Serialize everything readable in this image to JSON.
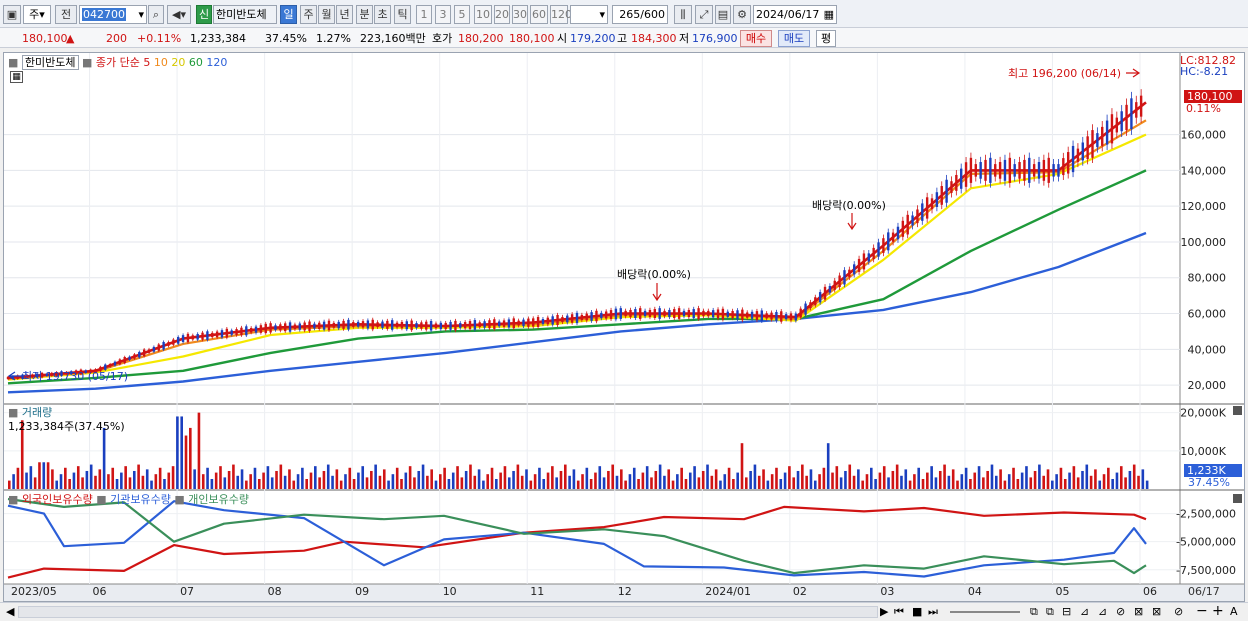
{
  "toolbar": {
    "period_type": "주",
    "prev_btn": "전",
    "stock_code": "042700",
    "credit_badge": "신",
    "stock_name": "한미반도체",
    "periods": [
      "일",
      "주",
      "월",
      "년",
      "분",
      "초",
      "틱"
    ],
    "active_period": "일",
    "tick_nums": [
      "1",
      "3",
      "5",
      "10",
      "20",
      "30",
      "60",
      "120"
    ],
    "count": "265",
    "count_max": "/600",
    "date": "2024/06/17"
  },
  "quote": {
    "price": "180,100",
    "change": "200",
    "change_pct": "+0.11%",
    "volume": "1,233,384",
    "turnover_rate": "37.45%",
    "ratio": "1.27%",
    "amount": "223,160백만",
    "ask_label": "호가",
    "ask": "180,200",
    "bid": "180,100",
    "open_label": "시",
    "open": "179,200",
    "high_label": "고",
    "high": "184,300",
    "low_label": "저",
    "low": "176,900",
    "buy_btn": "매수",
    "sell_btn": "매도",
    "eval_btn": "평"
  },
  "price_panel": {
    "legend_name": "한미반도체",
    "legend_ma": "종가 단순",
    "ma_labels": [
      "5",
      "10",
      "20",
      "60",
      "120"
    ],
    "lc": "LC:812.82",
    "hc": "HC:-8.21",
    "current_price_tag": "180,100",
    "current_pct_tag": "0.11%",
    "high_annotation": "최고 196,200 (06/14)",
    "low_annotation": "최저 19,730 (05/17)",
    "dividend_label_1": "배당락(0.00%)",
    "dividend_label_2": "배당락(0.00%)",
    "y_ticks": [
      "160,000",
      "140,000",
      "120,000",
      "100,000",
      "80,000",
      "60,000",
      "40,000",
      "20,000"
    ]
  },
  "volume_panel": {
    "title": "거래량",
    "value": "1,233,384주(37.45%)",
    "y_ticks": [
      "20,000K",
      "10,000K"
    ],
    "current_tag": "1,233K",
    "current_pct": "37.45%"
  },
  "holder_panel": {
    "legend_foreign": "외국인보유수량",
    "legend_inst": "기관보유수량",
    "legend_indiv": "개인보유수량",
    "y_ticks": [
      "-2,500,000",
      "-5,000,000",
      "-7,500,000"
    ]
  },
  "x_axis": {
    "labels": [
      "2023/05",
      "06",
      "07",
      "08",
      "09",
      "10",
      "11",
      "12",
      "2024/01",
      "02",
      "03",
      "04",
      "05",
      "06"
    ],
    "right_label": "06/17"
  },
  "colors": {
    "up": "#d01414",
    "down": "#1a3fbf",
    "ma5": "#d01414",
    "ma10": "#f08a1c",
    "ma20": "#f5e800",
    "ma60": "#1f9a3a",
    "ma120": "#2c5fd8",
    "foreign": "#d01414",
    "institution": "#2c5fd8",
    "individual": "#3a8f5a"
  },
  "chart_data": {
    "type": "line",
    "title": "",
    "x": [
      "2023/05",
      "2023/06",
      "2023/07",
      "2023/08",
      "2023/09",
      "2023/10",
      "2023/11",
      "2023/12",
      "2024/01",
      "2024/02",
      "2024/03",
      "2024/04",
      "2024/05",
      "2024/06"
    ],
    "ylim": [
      10000,
      200000
    ],
    "series": [
      {
        "name": "5",
        "values": [
          24000,
          28000,
          46000,
          52000,
          54000,
          53000,
          55000,
          60000,
          60000,
          58000,
          98000,
          140000,
          140000,
          178000
        ]
      },
      {
        "name": "10",
        "values": [
          23500,
          27500,
          43000,
          51000,
          53000,
          53000,
          54000,
          59000,
          60000,
          57000,
          95000,
          138000,
          139000,
          168000
        ]
      },
      {
        "name": "20",
        "values": [
          23000,
          27000,
          36000,
          48000,
          52000,
          52000,
          53000,
          58000,
          59000,
          56000,
          90000,
          130000,
          138000,
          160000
        ]
      },
      {
        "name": "60",
        "values": [
          21000,
          24000,
          28000,
          38000,
          46000,
          50000,
          51000,
          54000,
          57000,
          57000,
          68000,
          95000,
          118000,
          140000
        ]
      },
      {
        "name": "120",
        "values": [
          16000,
          18000,
          22000,
          28000,
          33000,
          38000,
          44000,
          50000,
          54000,
          57000,
          62000,
          72000,
          86000,
          105000
        ]
      }
    ]
  }
}
